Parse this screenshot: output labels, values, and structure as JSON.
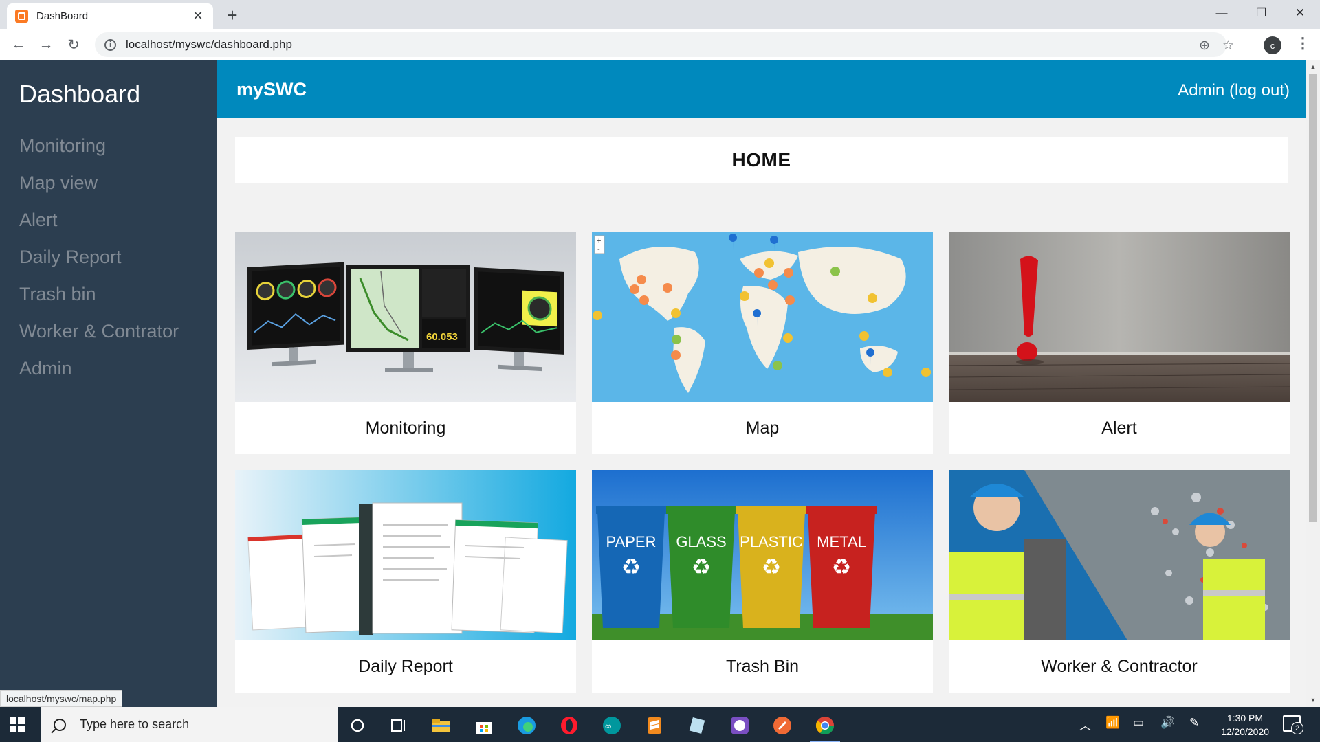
{
  "browser": {
    "tab_title": "DashBoard",
    "url": "localhost/myswc/dashboard.php",
    "profile_initial": "c",
    "status_url": "localhost/myswc/map.php"
  },
  "sidebar": {
    "title": "Dashboard",
    "items": [
      {
        "label": "Monitoring"
      },
      {
        "label": "Map view"
      },
      {
        "label": "Alert"
      },
      {
        "label": "Daily Report"
      },
      {
        "label": "Trash bin"
      },
      {
        "label": "Worker & Contrator"
      },
      {
        "label": "Admin"
      }
    ]
  },
  "header": {
    "brand": "mySWC",
    "user_link": "Admin (log out)",
    "color": "#0089bd"
  },
  "main": {
    "title": "HOME",
    "cards": [
      {
        "label": "Monitoring",
        "image": "monitoring-screens-illustration"
      },
      {
        "label": "Map",
        "image": "world-map-cluster-illustration"
      },
      {
        "label": "Alert",
        "image": "exclamation-mark-illustration"
      },
      {
        "label": "Daily Report",
        "image": "report-documents-illustration"
      },
      {
        "label": "Trash Bin",
        "image": "recycling-bins-illustration"
      },
      {
        "label": "Worker & Contractor",
        "image": "recycling-workers-illustration"
      }
    ],
    "bins": [
      "PAPER",
      "GLASS",
      "PLASTIC",
      "METAL"
    ],
    "monitor_readout": "60.053"
  },
  "taskbar": {
    "search_placeholder": "Type here to search",
    "time": "1:30 PM",
    "date": "12/20/2020",
    "notification_count": "2"
  },
  "colors": {
    "sidebar_bg": "#2c3e50",
    "sidebar_text": "#818a94",
    "page_bg": "#f2f2f2"
  }
}
